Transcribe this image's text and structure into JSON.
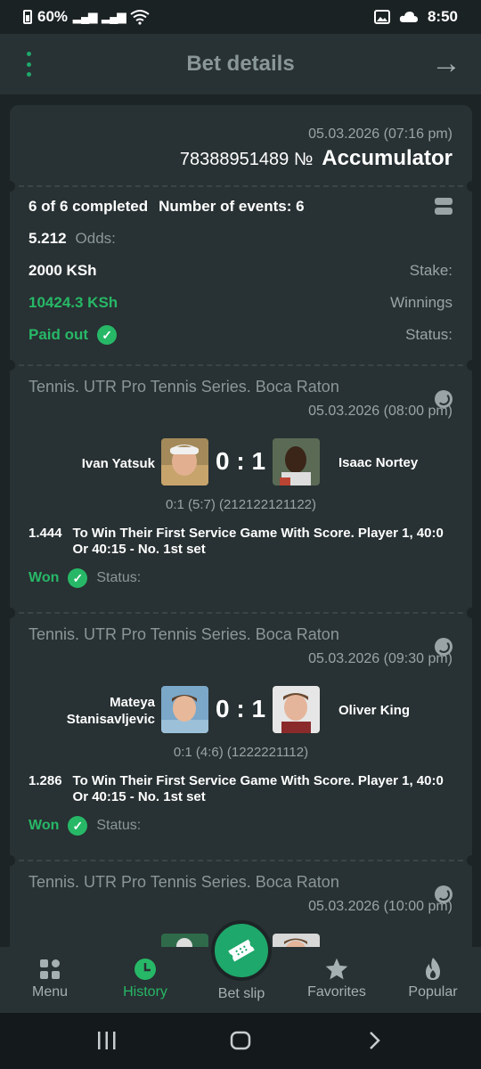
{
  "status_bar": {
    "battery": "60%",
    "time": "8:50"
  },
  "header": {
    "title": "Bet details"
  },
  "bet": {
    "date": "05.03.2026 (07:16 pm)",
    "number": "78388951489 №",
    "type": "Accumulator",
    "completed": "6 of 6 completed",
    "events_count": "Number of events: 6",
    "odds_value": "5.212",
    "odds_label": "Odds:",
    "stake_value": "2000 KSh",
    "stake_label": "Stake:",
    "winnings_value": "10424.3 KSh",
    "winnings_label": "Winnings",
    "status_value": "Paid out",
    "status_label": "Status:"
  },
  "events": [
    {
      "league": "Tennis. UTR Pro Tennis Series. Boca Raton",
      "date": "05.03.2026 (08:00 pm)",
      "player1": "Ivan Yatsuk",
      "player2": "Isaac Nortey",
      "score": "0 : 1",
      "detail": "0:1 (5:7) (212122121122)",
      "coef": "1.444",
      "pick": "To Win Their First Service Game With Score. Player 1, 40:0 Or 40:15 - No. 1st set",
      "result": "Won",
      "status_label": "Status:"
    },
    {
      "league": "Tennis. UTR Pro Tennis Series. Boca Raton",
      "date": "05.03.2026 (09:30 pm)",
      "player1": "Mateya Stanisavljevic",
      "player2": "Oliver King",
      "score": "0 : 1",
      "detail": "0:1 (4:6) (1222221112)",
      "coef": "1.286",
      "pick": "To Win Their First Service Game With Score. Player 1, 40:0 Or 40:15 - No. 1st set",
      "result": "Won",
      "status_label": "Status:"
    },
    {
      "league": "Tennis. UTR Pro Tennis Series. Boca Raton",
      "date": "05.03.2026 (10:00 pm)"
    }
  ],
  "bottom_nav": {
    "menu": "Menu",
    "history": "History",
    "bet_slip": "Bet slip",
    "favorites": "Favorites",
    "popular": "Popular"
  },
  "colors": {
    "accent": "#27b867",
    "background": "#1d2426",
    "card": "#283133"
  }
}
